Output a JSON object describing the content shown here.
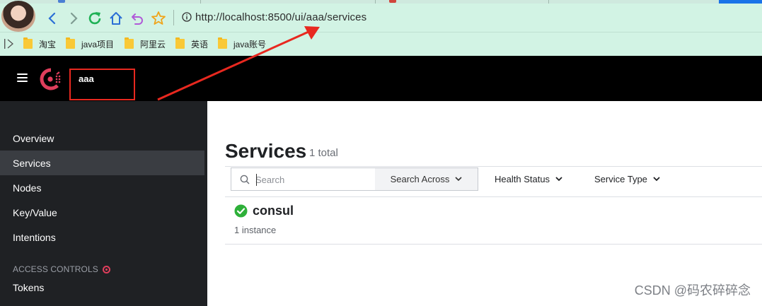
{
  "browser": {
    "url": "http://localhost:8500/ui/aaa/services",
    "bookmarks": [
      "淘宝",
      "java项目",
      "阿里云",
      "英语",
      "java账号"
    ]
  },
  "header": {
    "datacenter": "aaa"
  },
  "sidebar": {
    "items": [
      {
        "label": "Overview"
      },
      {
        "label": "Services"
      },
      {
        "label": "Nodes"
      },
      {
        "label": "Key/Value"
      },
      {
        "label": "Intentions"
      }
    ],
    "section_label": "ACCESS CONTROLS",
    "section_items": [
      {
        "label": "Tokens"
      }
    ]
  },
  "main": {
    "title": "Services",
    "count": "1 total",
    "search_placeholder": "Search",
    "search_across": "Search Across",
    "health_status": "Health Status",
    "service_type": "Service Type",
    "services": [
      {
        "name": "consul",
        "instances": "1 instance"
      }
    ]
  },
  "watermark": "CSDN @码农碎碎念",
  "colors": {
    "brand": "#e03e5c",
    "annotation": "#e8281f",
    "chrome": "#d2f3e4",
    "healthy": "#2eb039"
  }
}
